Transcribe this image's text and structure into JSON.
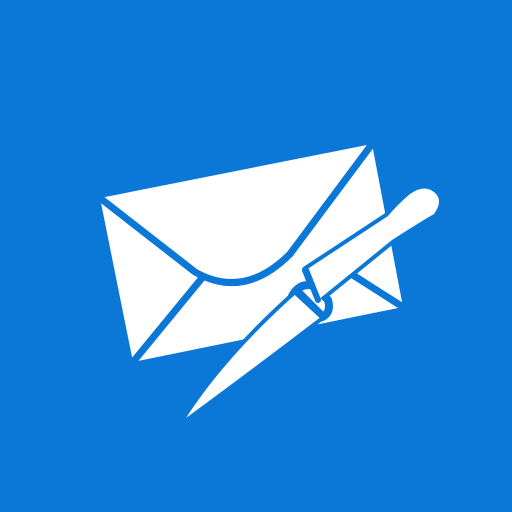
{
  "app_icon": {
    "icon_name": "envelope-letter-opener-icon",
    "background_color": "#0B78D7",
    "foreground_color": "#FFFFFF"
  }
}
